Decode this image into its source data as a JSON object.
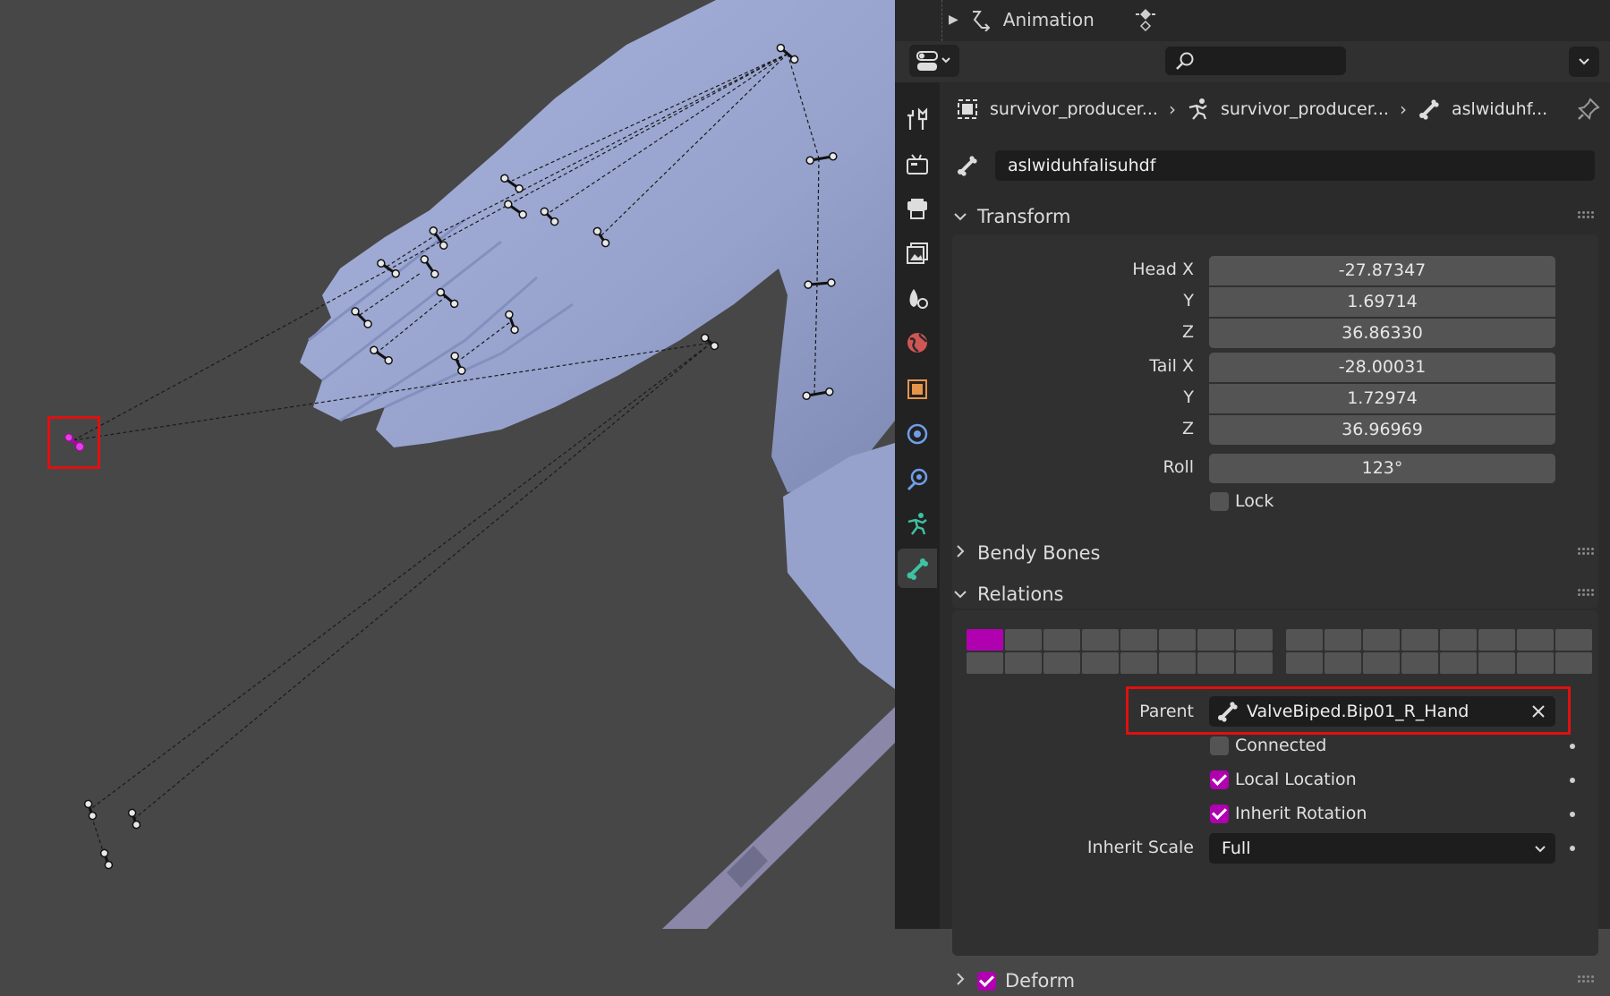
{
  "outliner": {
    "animation_label": "Animation"
  },
  "breadcrumb": {
    "item1": "survivor_producer...",
    "item2": "survivor_producer...",
    "item3": "aslwiduhf..."
  },
  "bone": {
    "name": "aslwiduhfalisuhdf"
  },
  "transform": {
    "title": "Transform",
    "head_x_label": "Head X",
    "head_y_label": "Y",
    "head_z_label": "Z",
    "head_x": "-27.87347",
    "head_y": "1.69714",
    "head_z": "36.86330",
    "tail_x_label": "Tail X",
    "tail_y_label": "Y",
    "tail_z_label": "Z",
    "tail_x": "-28.00031",
    "tail_y": "1.72974",
    "tail_z": "36.96969",
    "roll_label": "Roll",
    "roll": "123°",
    "lock_label": "Lock"
  },
  "bendy": {
    "title": "Bendy Bones"
  },
  "relations": {
    "title": "Relations",
    "parent_label": "Parent",
    "parent_value": "ValveBiped.Bip01_R_Hand",
    "connected_label": "Connected",
    "local_location_label": "Local Location",
    "inherit_rotation_label": "Inherit Rotation",
    "inherit_scale_label": "Inherit Scale",
    "inherit_scale_value": "Full"
  },
  "deform": {
    "title": "Deform"
  },
  "colors": {
    "accent": "#b000b0",
    "highlight": "#e01010",
    "mesh": "#96a2cc",
    "viewport_bg": "#474747"
  }
}
